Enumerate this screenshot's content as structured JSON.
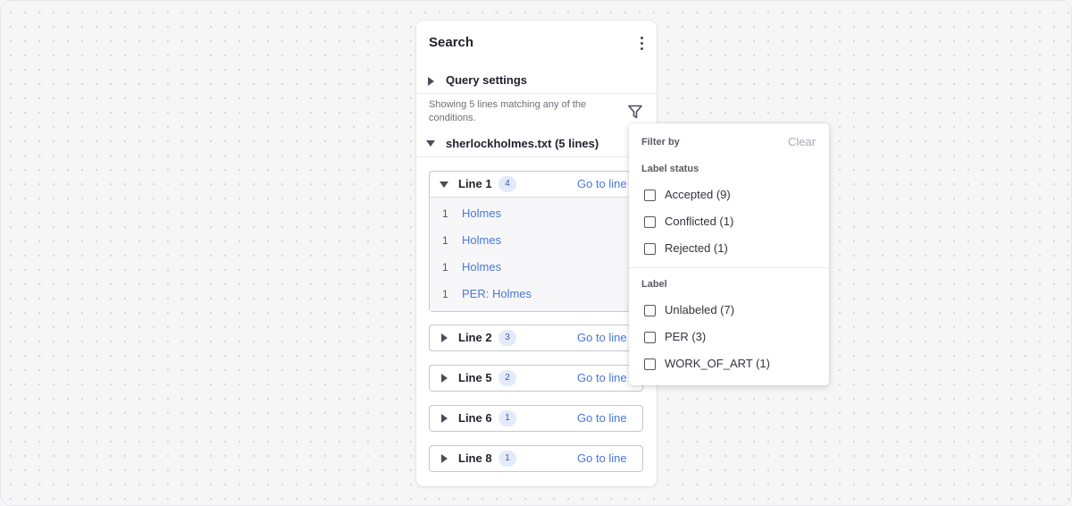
{
  "panel": {
    "title": "Search",
    "query_settings_label": "Query settings",
    "showing_text": "Showing 5 lines matching any of the conditions.",
    "file_label": "sherlockholmes.txt (5 lines)"
  },
  "lines": [
    {
      "label": "Line 1",
      "count": "4",
      "goto": "Go to line",
      "expanded": true,
      "matches": [
        {
          "num": "1",
          "text": "Holmes"
        },
        {
          "num": "1",
          "text": "Holmes"
        },
        {
          "num": "1",
          "text": "Holmes"
        },
        {
          "num": "1",
          "text": "PER: Holmes"
        }
      ]
    },
    {
      "label": "Line 2",
      "count": "3",
      "goto": "Go to line",
      "expanded": false
    },
    {
      "label": "Line 5",
      "count": "2",
      "goto": "Go to line",
      "expanded": false
    },
    {
      "label": "Line 6",
      "count": "1",
      "goto": "Go to line",
      "expanded": false
    },
    {
      "label": "Line 8",
      "count": "1",
      "goto": "Go to line",
      "expanded": false
    }
  ],
  "filter": {
    "title": "Filter by",
    "clear_label": "Clear",
    "label_status_heading": "Label status",
    "label_status_options": [
      {
        "text": "Accepted (9)",
        "checked": false
      },
      {
        "text": "Conflicted (1)",
        "checked": false
      },
      {
        "text": "Rejected (1)",
        "checked": false
      }
    ],
    "label_heading": "Label",
    "label_options": [
      {
        "text": "Unlabeled (7)",
        "checked": false
      },
      {
        "text": "PER (3)",
        "checked": false
      },
      {
        "text": "WORK_OF_ART (1)",
        "checked": false
      }
    ]
  },
  "colors": {
    "accent": "#4a78d6",
    "badge_bg": "#e3ebfa",
    "badge_text": "#3b5bb0"
  }
}
